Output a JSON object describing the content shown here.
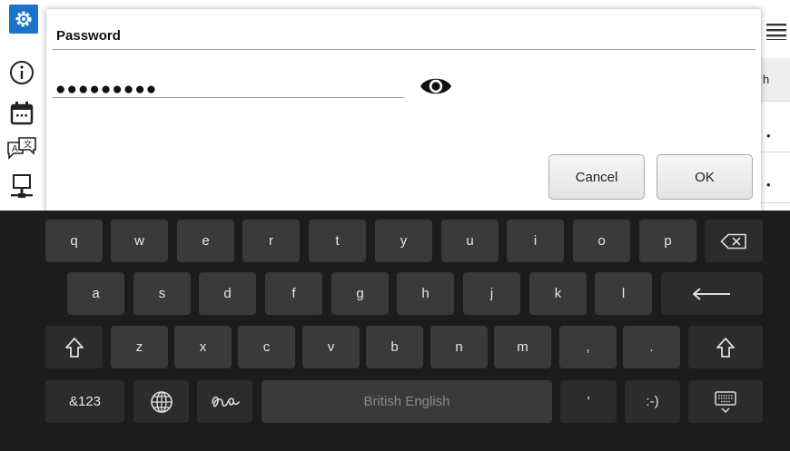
{
  "dialog": {
    "title": "Password",
    "password_value": "●●●●●●●●●",
    "cancel_label": "Cancel",
    "ok_label": "OK",
    "eye_icon": "eye-icon"
  },
  "sidebar": {
    "icons": [
      "gear-icon",
      "info-icon",
      "calendar-icon",
      "language-icon",
      "network-icon"
    ],
    "accent": "#1a73c9"
  },
  "right_strip": {
    "cells": [
      "",
      "h",
      "•",
      "•"
    ],
    "icon": "hamburger-menu-icon"
  },
  "keyboard": {
    "row1": [
      "q",
      "w",
      "e",
      "r",
      "t",
      "y",
      "u",
      "i",
      "o",
      "p"
    ],
    "row2": [
      "a",
      "s",
      "d",
      "f",
      "g",
      "h",
      "j",
      "k",
      "l"
    ],
    "row3": [
      "z",
      "x",
      "c",
      "v",
      "b",
      "n",
      "m",
      ",",
      "."
    ],
    "symbols_label": "&123",
    "space_label": "British English",
    "apostrophe_label": "'",
    "emoticon_label": ":-)",
    "backspace_icon": "backspace-icon",
    "enter_icon": "enter-icon",
    "shift_icon": "shift-icon",
    "globe_icon": "globe-icon",
    "handwriting_icon": "handwriting-icon",
    "hide_keyboard_icon": "keyboard-hide-icon"
  }
}
